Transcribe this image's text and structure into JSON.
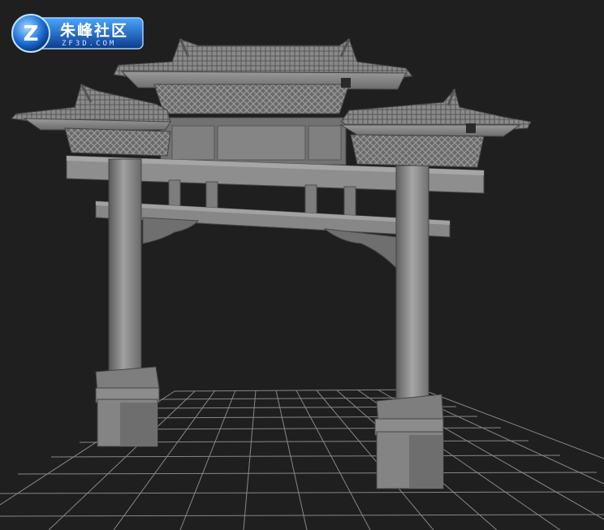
{
  "watermark": {
    "title": "朱峰社区",
    "subtitle": "ZF3D.COM",
    "badge_letter": "Z"
  },
  "viewport": {
    "background": "#1f1f1f",
    "grid_color": "#9a9a9a",
    "model_color": "#8c8c8c",
    "model": "paifang-archway-icon"
  }
}
